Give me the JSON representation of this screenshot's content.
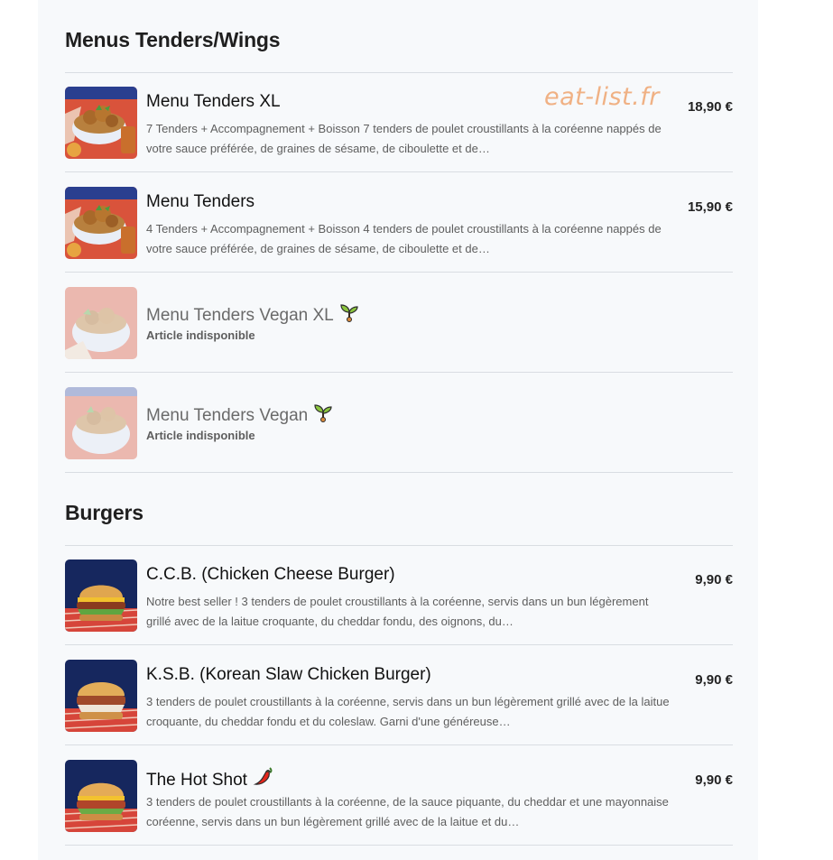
{
  "sections": [
    {
      "title": "Menus Tenders/Wings",
      "items": [
        {
          "name": "Menu Tenders XL",
          "description": "7 Tenders + Accompagnement + Boisson 7 tenders de poulet croustillants à la coréenne nappés de votre sauce préférée, de graines de sésame, de ciboulette et de…",
          "price": "18,90 €"
        },
        {
          "name": "Menu Tenders",
          "description": "4 Tenders + Accompagnement + Boisson 4 tenders de poulet croustillants à la coréenne nappés de votre sauce préférée, de graines de sésame, de ciboulette et de…",
          "price": "15,90 €"
        },
        {
          "name": "Menu Tenders Vegan XL",
          "badge_icon": "seedling-icon",
          "status": "Article indisponible"
        },
        {
          "name": "Menu Tenders Vegan",
          "badge_icon": "seedling-icon",
          "status": "Article indisponible"
        }
      ]
    },
    {
      "title": "Burgers",
      "items": [
        {
          "name": "C.C.B. (Chicken Cheese Burger)",
          "description": "Notre best seller ! 3 tenders de poulet croustillants à la coréenne, servis dans un bun légèrement grillé avec de la laitue croquante, du cheddar fondu, des oignons, du…",
          "price": "9,90 €"
        },
        {
          "name": "K.S.B. (Korean Slaw Chicken Burger)",
          "description": "3 tenders de poulet croustillants à la coréenne, servis dans un bun légèrement grillé avec de la laitue croquante, du cheddar fondu et du coleslaw. Garni d'une généreuse…",
          "price": "9,90 €"
        },
        {
          "name": "The Hot Shot",
          "badge_icon": "chili-pepper-icon",
          "description": "3 tenders de poulet croustillants à la coréenne, de la sauce piquante, du cheddar et une mayonnaise coréenne, servis dans un bun légèrement grillé avec de la laitue et du…",
          "price": "9,90 €"
        }
      ]
    }
  ],
  "watermark": "eat-list.fr",
  "colors": {
    "panel_bg": "#f7f9fb",
    "divider": "#d9dde2",
    "watermark": "#f0b184"
  }
}
